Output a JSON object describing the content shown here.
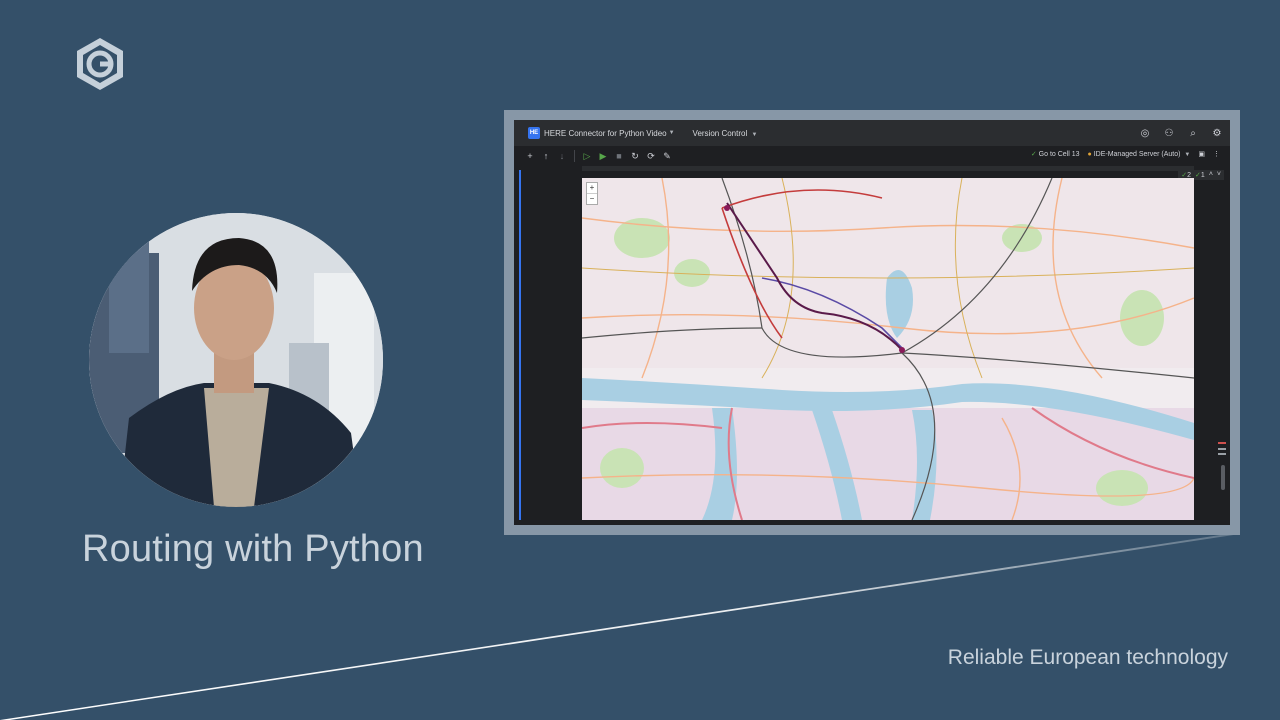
{
  "slide": {
    "title": "Routing with Python",
    "tagline": "Reliable European technology",
    "background_color": "#345069",
    "logo_icon": "hexagon-c-logo"
  },
  "ide": {
    "project_badge": "HE",
    "project_name": "HERE Connector for Python Video",
    "version_control": "Version Control",
    "goto_cell": "Go to Cell 13",
    "server": "IDE-Managed Server (Auto)",
    "inspections": {
      "ok_a": "2",
      "ok_b": "1"
    },
    "map_zoom_in": "+",
    "map_zoom_out": "−"
  }
}
